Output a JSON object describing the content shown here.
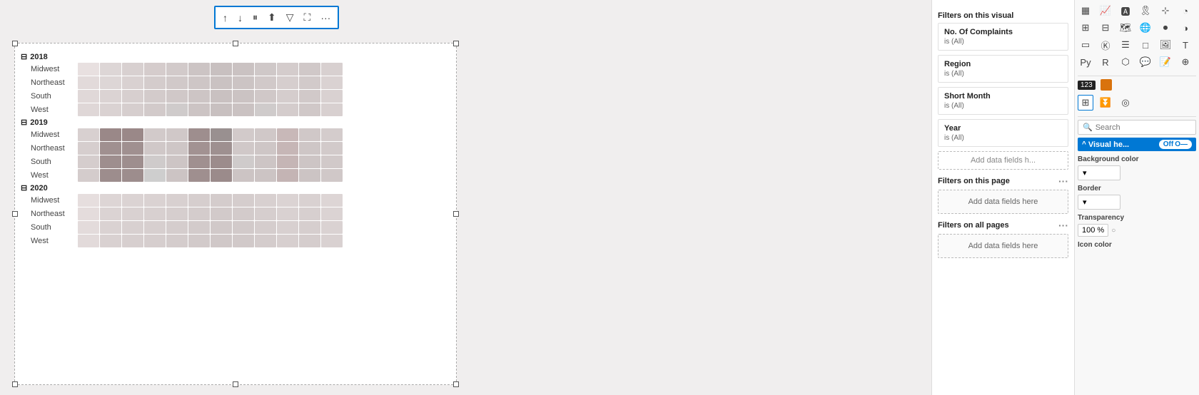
{
  "toolbar": {
    "buttons": [
      "↑",
      "↓",
      "||",
      "⬆",
      "▽",
      "⛶",
      "···"
    ]
  },
  "heatmap": {
    "years": [
      {
        "label": "2018",
        "regions": [
          {
            "name": "Midwest",
            "cells": [
              "#e8e0e0",
              "#ddd6d6",
              "#d8d0d0",
              "#d5cccc",
              "#d2caca",
              "#ccc4c4",
              "#c8c0c0",
              "#cac2c2",
              "#cfc8c8",
              "#d4cccc",
              "#d0c8c8",
              "#d8d0d0"
            ]
          },
          {
            "name": "Northeast",
            "cells": [
              "#e2dada",
              "#ddd6d6",
              "#d9d1d1",
              "#d4cccc",
              "#d1c9c9",
              "#cec6c6",
              "#cac2c2",
              "#ccc4c4",
              "#d1c9c9",
              "#d6cece",
              "#d2caca",
              "#dad2d2"
            ]
          },
          {
            "name": "South",
            "cells": [
              "#e0d8d8",
              "#dbd3d3",
              "#d7cfcf",
              "#d3cbcb",
              "#d0c8c8",
              "#cdc5c5",
              "#c9c1c1",
              "#cbc3c3",
              "#d0c8c8",
              "#d5cdcd",
              "#d1c9c9",
              "#d9d1d1"
            ]
          },
          {
            "name": "West",
            "cells": [
              "#dfd7d7",
              "#dad2d2",
              "#d6cece",
              "#d2caca",
              "#cfcbcb",
              "#ccc4c4",
              "#c8c0c0",
              "#cac2c2",
              "#cfcbcb",
              "#d4cccc",
              "#d0c8c8",
              "#d8d0d0"
            ]
          }
        ]
      },
      {
        "label": "2019",
        "regions": [
          {
            "name": "Midwest",
            "cells": [
              "#d8d0d0",
              "#9a8888",
              "#9a8888",
              "#d2caca",
              "#d0c8c8",
              "#9e8e8e",
              "#999090",
              "#d2caca",
              "#d0c8c8",
              "#c8b8b8",
              "#d0c8c8",
              "#d4cccc"
            ]
          },
          {
            "name": "Northeast",
            "cells": [
              "#d6cece",
              "#a09090",
              "#a09090",
              "#d0c8c8",
              "#cec6c6",
              "#a29292",
              "#9e9090",
              "#d0c8c8",
              "#cec6c6",
              "#c6b6b6",
              "#cec6c6",
              "#d2caca"
            ]
          },
          {
            "name": "South",
            "cells": [
              "#d5cdcd",
              "#9e8e8e",
              "#9e8e8e",
              "#cfcbcb",
              "#cdc5c5",
              "#a09090",
              "#9c8c8c",
              "#cfcbcb",
              "#cdc5c5",
              "#c5b5b5",
              "#cdc5c5",
              "#d1c9c9"
            ]
          },
          {
            "name": "West",
            "cells": [
              "#d4cccc",
              "#9d8d8d",
              "#9d8d8d",
              "#cecece",
              "#ccc4c4",
              "#9f8f8f",
              "#9b8b8b",
              "#ccc4c4",
              "#ccc4c4",
              "#c4b4b4",
              "#ccc4c4",
              "#d0c8c8"
            ]
          }
        ]
      },
      {
        "label": "2020",
        "regions": [
          {
            "name": "Midwest",
            "cells": [
              "#e6dede",
              "#ddd5d5",
              "#dbd3d3",
              "#dad2d2",
              "#d8d0d0",
              "#d6cece",
              "#d4cccc",
              "#d5cdcd",
              "#d8d0d0",
              "#dbd3d3",
              "#d9d1d1",
              "#ddd5d5"
            ]
          },
          {
            "name": "Northeast",
            "cells": [
              "#e4dcdc",
              "#dbd3d3",
              "#d9d1d1",
              "#d8d0d0",
              "#d6cece",
              "#d4cccc",
              "#d2caca",
              "#d3cbcb",
              "#d6cece",
              "#d9d1d1",
              "#d7cfcf",
              "#dbd3d3"
            ]
          },
          {
            "name": "South",
            "cells": [
              "#e3dbdb",
              "#dad2d2",
              "#d8d0d0",
              "#d7cfcf",
              "#d5cdcd",
              "#d3cbcb",
              "#d1c9c9",
              "#d2caca",
              "#d5cdcd",
              "#d8d0d0",
              "#d6cece",
              "#dad2d2"
            ]
          },
          {
            "name": "West",
            "cells": [
              "#e2dada",
              "#d9d1d1",
              "#d7cfcf",
              "#d6cece",
              "#d4cccc",
              "#d2caca",
              "#d0c8c8",
              "#d1c9c9",
              "#d4cccc",
              "#d7cfcf",
              "#d5cdcd",
              "#d9d1d1"
            ]
          }
        ]
      }
    ]
  },
  "filters_panel": {
    "filters_on_visual": "Filters on this visual",
    "filters_on_page": "Filters on this page",
    "filters_on_all_pages": "Filters on all pages",
    "add_data_label": "Add data fields here",
    "filter_items": [
      {
        "title": "No. Of Complaints",
        "value": "is (All)"
      },
      {
        "title": "Region",
        "value": "is (All)"
      },
      {
        "title": "Short Month",
        "value": "is (All)"
      },
      {
        "title": "Year",
        "value": "is (All)"
      }
    ],
    "add_data_fields_he": "Add data fields h..."
  },
  "viz_panel": {
    "search_placeholder": "Search",
    "visual_header_label": "Visual he...",
    "toggle_state": "Off",
    "background_color_label": "Background color",
    "border_label": "Border",
    "transparency_label": "Transparency",
    "transparency_value": "100 %",
    "icon_color_label": "Icon color",
    "icons": [
      "table",
      "bar",
      "line",
      "area",
      "scatter",
      "pie",
      "donut",
      "map",
      "treemap",
      "matrix",
      "card",
      "gauge",
      "kpi",
      "ribbon",
      "waterfall",
      "funnel",
      "py",
      "r",
      "sql",
      "custom",
      "aa",
      "image",
      "more1",
      "more2"
    ]
  }
}
